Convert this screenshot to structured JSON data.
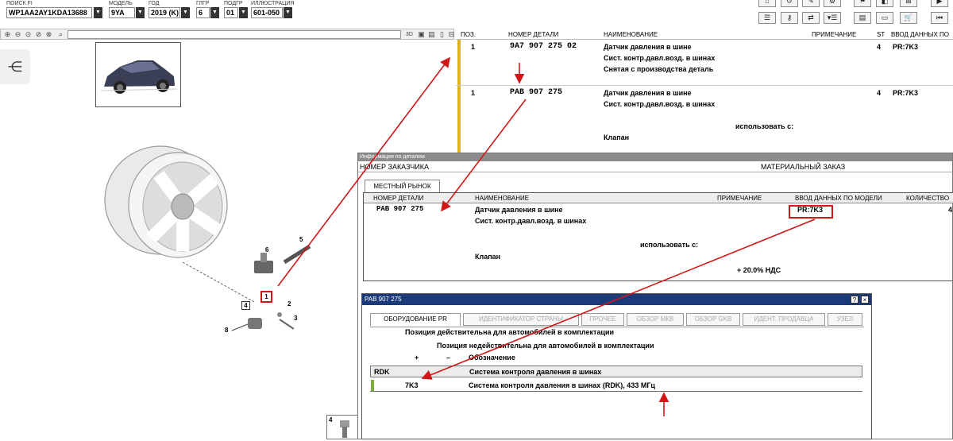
{
  "toolbar": {
    "fields": [
      {
        "label": "ПОИСК FI",
        "value": "WP1AA2AY1KDA13688"
      },
      {
        "label": "МОДЕЛЬ",
        "value": "9YA"
      },
      {
        "label": "ГОД",
        "value": "2019 (K)"
      },
      {
        "label": "ГЛГР",
        "value": "6"
      },
      {
        "label": "ПОДГР",
        "value": "01"
      },
      {
        "label": "ИЛЛЮСТРАЦИЯ",
        "value": "601-050"
      }
    ]
  },
  "left_toolbar": {
    "view3d": "3D"
  },
  "diagram": {
    "callouts": [
      "6",
      "5",
      "1",
      "4",
      "2",
      "3",
      "8",
      "4"
    ]
  },
  "parts_table": {
    "headers": {
      "pos": "ПОЗ.",
      "part": "НОМЕР ДЕТАЛИ",
      "name": "НАИМЕНОВАНИЕ",
      "note": "ПРИМЕЧАНИЕ",
      "st": "ST",
      "model": "ВВОД ДАННЫХ ПО"
    },
    "rows": [
      {
        "pos": "1",
        "part": "9A7 907 275 02",
        "name": [
          "Датчик давления в шине",
          "Сист. контр.давл.возд. в шинах",
          "Снятая с производства деталь"
        ],
        "st": "4",
        "model": "PR:7K3"
      },
      {
        "pos": "1",
        "part": "PAB 907 275",
        "name": [
          "Датчик давления в шине",
          "Сист. контр.давл.возд. в шинах"
        ],
        "use_with": "использовать с:",
        "extra": "Клапан",
        "st": "4",
        "model": "PR:7K3"
      }
    ]
  },
  "info_window": {
    "title": "Информация по деталям",
    "customer_no_label": "НОМЕР ЗАКАЗЧИКА",
    "material_order_label": "МАТЕРИАЛЬНЫЙ ЗАКАЗ",
    "tab": "МЕСТНЫЙ РЫНОК",
    "headers": {
      "part": "НОМЕР ДЕТАЛИ",
      "name": "НАИМЕНОВАНИЕ",
      "note": "ПРИМЕЧАНИЕ",
      "model": "ВВОД ДАННЫХ ПО МОДЕЛИ",
      "qty": "КОЛИЧЕСТВО"
    },
    "row": {
      "part": "PAB 907 275",
      "name1": "Датчик давления в шине",
      "name2": "Сист. контр.давл.возд. в шинах",
      "use_with": "использовать с:",
      "valve": "Клапан",
      "vat": "+ 20.0% НДС",
      "model": "PR:7K3",
      "qty": "4"
    }
  },
  "pr_dialog": {
    "title": "PAB 907 275",
    "help": "?",
    "close": "×",
    "tabs": [
      "ОБОРУДОВАНИЕ PR",
      "ИДЕНТИФИКАТОР СТРАНЫ",
      "ПРОЧЕЕ",
      "ОБЗОР МКВ",
      "ОБЗОР GKB",
      "ИДЕНТ. ПРОДАВЦА",
      "УЗЕЛ"
    ],
    "line_valid": "Позиция действительна для автомобилей в комплектации",
    "line_invalid": "Позиция недействительна для автомобилей в комплектации",
    "plus": "+",
    "minus": "–",
    "designation": "Обозначение",
    "family_code": "RDK",
    "family_name": "Система контроля давления в шинах",
    "option_code": "7K3",
    "option_name": "Система контроля давления в шинах (RDK), 433 МГц"
  },
  "colors": {
    "annotation_red": "#d01818",
    "highlight_yellow": "#e0b22a",
    "title_blue": "#1b3a7a"
  }
}
